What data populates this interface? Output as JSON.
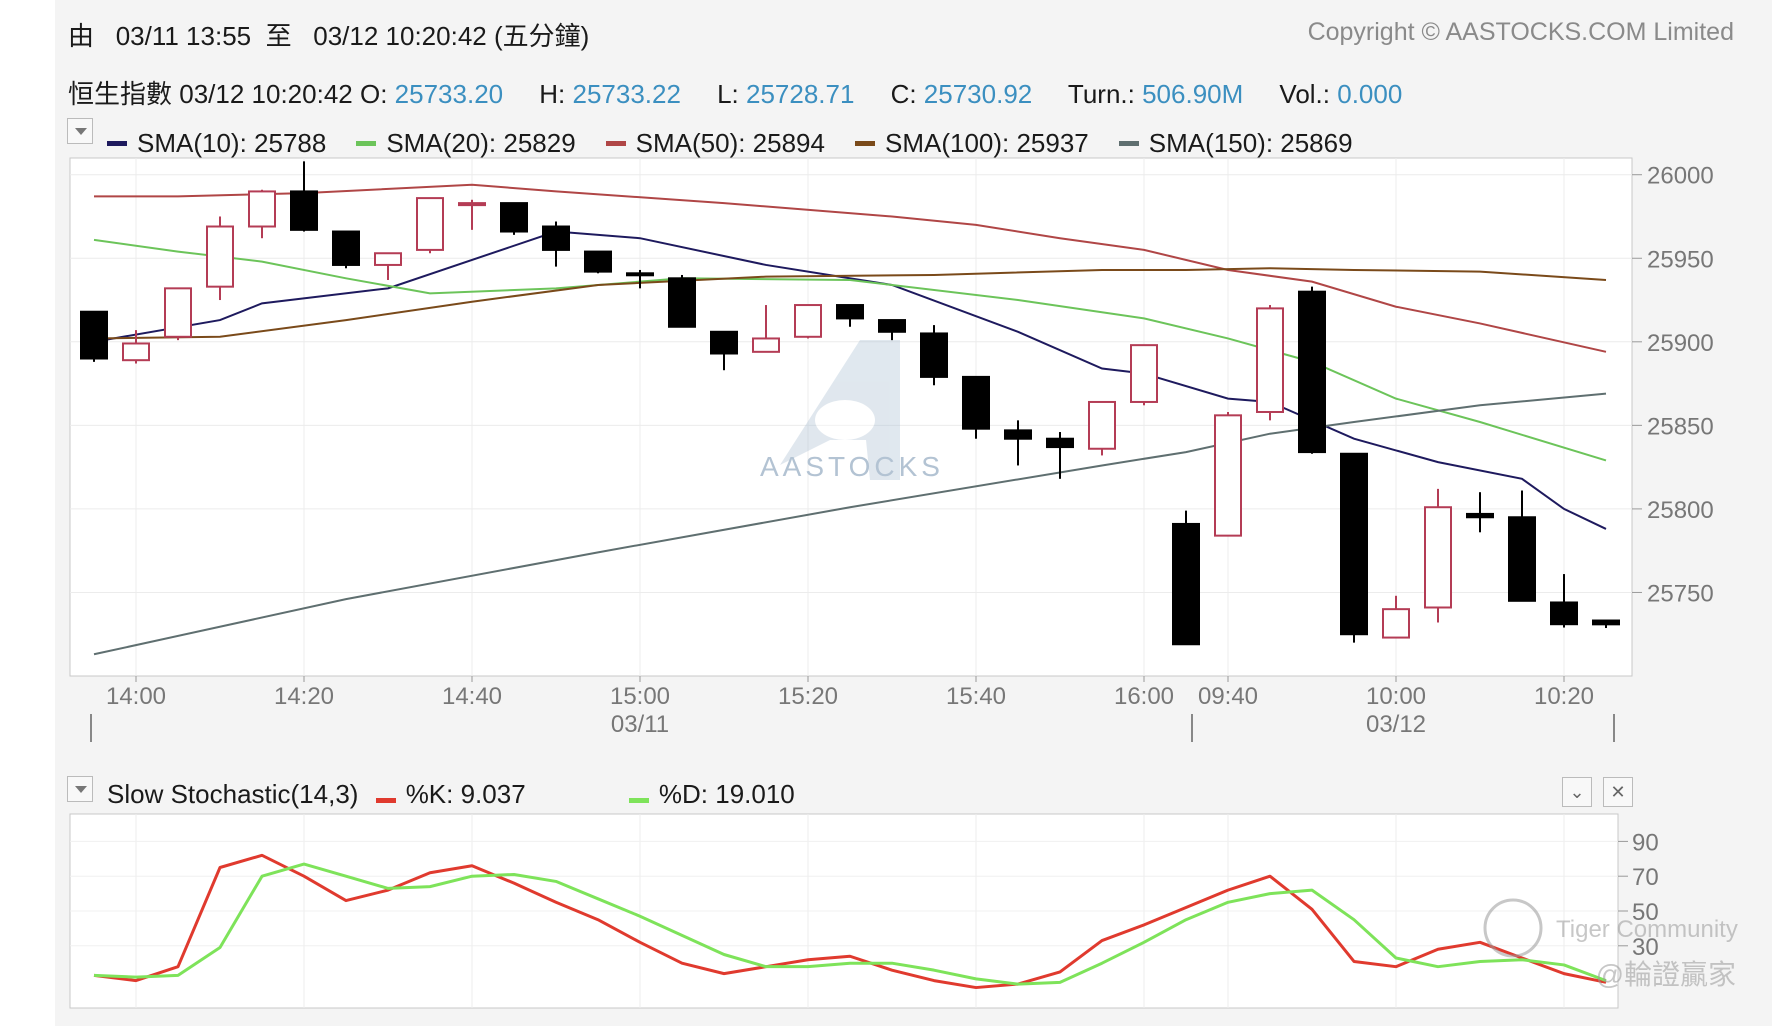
{
  "header": {
    "range_prefix": "由",
    "range_from": "03/11 13:55",
    "range_mid": "至",
    "range_to": "03/12 10:20:42 (五分鐘)",
    "copyright": "Copyright © AASTOCKS.COM Limited"
  },
  "quote": {
    "name": "恒生指數",
    "time": "03/12 10:20:42",
    "open_label": "O:",
    "open": "25733.20",
    "high_label": "H:",
    "high": "25733.22",
    "low_label": "L:",
    "low": "25728.71",
    "close_label": "C:",
    "close": "25730.92",
    "turn_label": "Turn.:",
    "turn": "506.90M",
    "vol_label": "Vol.:",
    "vol": "0.000"
  },
  "sma_legend": [
    {
      "label": "SMA(10): 25788",
      "color": "#1e1a5e"
    },
    {
      "label": "SMA(20): 25829",
      "color": "#6cc45a"
    },
    {
      "label": "SMA(50): 25894",
      "color": "#b04646"
    },
    {
      "label": "SMA(100): 25937",
      "color": "#7a4a1a"
    },
    {
      "label": "SMA(150): 25869",
      "color": "#5f6f70"
    }
  ],
  "stoch_legend": {
    "title": "Slow Stochastic(14,3)",
    "k_label": "%K: 9.037",
    "k_color": "#e03a2e",
    "d_label": "%D: 19.010",
    "d_color": "#7ee35a"
  },
  "watermarks": {
    "center": "AASTOCKS",
    "community": "Tiger Community",
    "author": "@輪證贏家"
  },
  "chart_data": [
    {
      "type": "candlestick",
      "title": "恒生指數",
      "ylim": [
        25700,
        26010
      ],
      "y_ticks": [
        26000,
        25950,
        25900,
        25850,
        25800,
        25750
      ],
      "x_tick_labels": [
        "14:00",
        "14:20",
        "14:40",
        "15:00",
        "15:20",
        "15:40",
        "16:00",
        "09:40",
        "10:00",
        "10:20"
      ],
      "date_labels": [
        "03/11",
        "03/12"
      ],
      "bull_color": "#b43c55",
      "bear_color": "#000000",
      "candles": [
        {
          "time": "13:55",
          "o": 25918,
          "h": 25918,
          "l": 25888,
          "c": 25890
        },
        {
          "time": "14:00",
          "o": 25889,
          "h": 25907,
          "l": 25887,
          "c": 25899
        },
        {
          "time": "14:05",
          "o": 25903,
          "h": 25931,
          "l": 25901,
          "c": 25932
        },
        {
          "time": "14:10",
          "o": 25933,
          "h": 25975,
          "l": 25925,
          "c": 25969
        },
        {
          "time": "14:15",
          "o": 25969,
          "h": 25991,
          "l": 25962,
          "c": 25990
        },
        {
          "time": "14:20",
          "o": 25990,
          "h": 26008,
          "l": 25966,
          "c": 25967
        },
        {
          "time": "14:25",
          "o": 25966,
          "h": 25966,
          "l": 25944,
          "c": 25946
        },
        {
          "time": "14:30",
          "o": 25946,
          "h": 25951,
          "l": 25937,
          "c": 25953
        },
        {
          "time": "14:35",
          "o": 25955,
          "h": 25986,
          "l": 25953,
          "c": 25986
        },
        {
          "time": "14:40",
          "o": 25983,
          "h": 25985,
          "l": 25967,
          "c": 25983
        },
        {
          "time": "14:45",
          "o": 25983,
          "h": 25983,
          "l": 25964,
          "c": 25966
        },
        {
          "time": "14:50",
          "o": 25969,
          "h": 25972,
          "l": 25945,
          "c": 25955
        },
        {
          "time": "14:55",
          "o": 25954,
          "h": 25954,
          "l": 25941,
          "c": 25942
        },
        {
          "time": "15:00",
          "o": 25941,
          "h": 25943,
          "l": 25932,
          "c": 25940
        },
        {
          "time": "15:05",
          "o": 25938,
          "h": 25940,
          "l": 25909,
          "c": 25909
        },
        {
          "time": "15:10",
          "o": 25906,
          "h": 25906,
          "l": 25883,
          "c": 25893
        },
        {
          "time": "15:15",
          "o": 25894,
          "h": 25922,
          "l": 25894,
          "c": 25902
        },
        {
          "time": "15:20",
          "o": 25903,
          "h": 25922,
          "l": 25902,
          "c": 25922
        },
        {
          "time": "15:25",
          "o": 25922,
          "h": 25922,
          "l": 25909,
          "c": 25914
        },
        {
          "time": "15:30",
          "o": 25913,
          "h": 25913,
          "l": 25901,
          "c": 25906
        },
        {
          "time": "15:35",
          "o": 25905,
          "h": 25910,
          "l": 25874,
          "c": 25879
        },
        {
          "time": "15:40",
          "o": 25879,
          "h": 25879,
          "l": 25842,
          "c": 25848
        },
        {
          "time": "15:45",
          "o": 25847,
          "h": 25853,
          "l": 25826,
          "c": 25842
        },
        {
          "time": "15:50",
          "o": 25842,
          "h": 25846,
          "l": 25818,
          "c": 25837
        },
        {
          "time": "15:55",
          "o": 25836,
          "h": 25864,
          "l": 25832,
          "c": 25864
        },
        {
          "time": "16:00",
          "o": 25864,
          "h": 25898,
          "l": 25862,
          "c": 25898
        },
        {
          "time": "09:35",
          "o": 25791,
          "h": 25799,
          "l": 25719,
          "c": 25719
        },
        {
          "time": "09:40",
          "o": 25784,
          "h": 25858,
          "l": 25784,
          "c": 25856
        },
        {
          "time": "09:45",
          "o": 25858,
          "h": 25922,
          "l": 25853,
          "c": 25920
        },
        {
          "time": "09:50",
          "o": 25930,
          "h": 25933,
          "l": 25833,
          "c": 25834
        },
        {
          "time": "09:55",
          "o": 25833,
          "h": 25833,
          "l": 25720,
          "c": 25725
        },
        {
          "time": "10:00",
          "o": 25723,
          "h": 25748,
          "l": 25723,
          "c": 25740
        },
        {
          "time": "10:05",
          "o": 25741,
          "h": 25812,
          "l": 25732,
          "c": 25801
        },
        {
          "time": "10:10",
          "o": 25797,
          "h": 25810,
          "l": 25786,
          "c": 25795
        },
        {
          "time": "10:15",
          "o": 25795,
          "h": 25811,
          "l": 25745,
          "c": 25745
        },
        {
          "time": "10:20",
          "o": 25744,
          "h": 25761,
          "l": 25729,
          "c": 25731
        },
        {
          "time": "10:20:42",
          "o": 25733.2,
          "h": 25733.22,
          "l": 25728.71,
          "c": 25730.92
        }
      ],
      "sma": [
        {
          "name": "SMA(10)",
          "color": "#1e1a5e",
          "points": [
            [
              0,
              25900
            ],
            [
              3,
              25913
            ],
            [
              4,
              25923
            ],
            [
              7,
              25932
            ],
            [
              11,
              25966
            ],
            [
              13,
              25962
            ],
            [
              16,
              25946
            ],
            [
              19,
              25934
            ],
            [
              22,
              25906
            ],
            [
              24,
              25884
            ],
            [
              25,
              25881
            ],
            [
              27,
              25866
            ],
            [
              28,
              25864
            ],
            [
              30,
              25842
            ],
            [
              32,
              25828
            ],
            [
              34,
              25818
            ],
            [
              35,
              25800
            ],
            [
              36,
              25788
            ]
          ]
        },
        {
          "name": "SMA(20)",
          "color": "#6cc45a",
          "points": [
            [
              0,
              25961
            ],
            [
              2,
              25954
            ],
            [
              4,
              25948
            ],
            [
              6,
              25938
            ],
            [
              8,
              25929
            ],
            [
              11,
              25932
            ],
            [
              14,
              25938
            ],
            [
              18,
              25937
            ],
            [
              22,
              25925
            ],
            [
              25,
              25914
            ],
            [
              27,
              25902
            ],
            [
              29,
              25888
            ],
            [
              31,
              25866
            ],
            [
              33,
              25852
            ],
            [
              36,
              25829
            ]
          ]
        },
        {
          "name": "SMA(50)",
          "color": "#b04646",
          "points": [
            [
              0,
              25987
            ],
            [
              2,
              25987
            ],
            [
              5,
              25989
            ],
            [
              9,
              25994
            ],
            [
              11,
              25990
            ],
            [
              15,
              25983
            ],
            [
              19,
              25975
            ],
            [
              21,
              25970
            ],
            [
              23,
              25962
            ],
            [
              25,
              25955
            ],
            [
              27,
              25943
            ],
            [
              29,
              25936
            ],
            [
              31,
              25921
            ],
            [
              33,
              25911
            ],
            [
              36,
              25894
            ]
          ]
        },
        {
          "name": "SMA(100)",
          "color": "#7a4a1a",
          "points": [
            [
              0,
              25902
            ],
            [
              3,
              25903
            ],
            [
              6,
              25913
            ],
            [
              9,
              25924
            ],
            [
              12,
              25934
            ],
            [
              16,
              25939
            ],
            [
              20,
              25940
            ],
            [
              24,
              25943
            ],
            [
              26,
              25943
            ],
            [
              28,
              25944
            ],
            [
              30,
              25943
            ],
            [
              33,
              25942
            ],
            [
              36,
              25937
            ]
          ]
        },
        {
          "name": "SMA(150)",
          "color": "#5f6f70",
          "points": [
            [
              0,
              25713
            ],
            [
              6,
              25746
            ],
            [
              12,
              25774
            ],
            [
              18,
              25801
            ],
            [
              24,
              25826
            ],
            [
              26,
              25834
            ],
            [
              28,
              25845
            ],
            [
              30,
              25852
            ],
            [
              33,
              25862
            ],
            [
              36,
              25869
            ]
          ]
        }
      ]
    },
    {
      "type": "line",
      "title": "Slow Stochastic(14,3)",
      "ylim": [
        0,
        100
      ],
      "y_ticks": [
        90,
        70,
        50,
        30
      ],
      "series": [
        {
          "name": "%K",
          "color": "#e03a2e",
          "values": [
            13,
            10,
            18,
            75,
            82,
            70,
            56,
            62,
            72,
            76,
            66,
            55,
            45,
            32,
            20,
            14,
            18,
            22,
            24,
            16,
            10,
            6,
            8,
            15,
            33,
            42,
            52,
            62,
            70,
            51,
            21,
            18,
            28,
            32,
            23,
            14,
            9
          ]
        },
        {
          "name": "%D",
          "color": "#7ee35a",
          "values": [
            13,
            12,
            13,
            29,
            70,
            77,
            70,
            63,
            64,
            70,
            71,
            67,
            57,
            47,
            36,
            25,
            18,
            18,
            20,
            20,
            16,
            11,
            8,
            9,
            20,
            32,
            45,
            55,
            60,
            62,
            45,
            23,
            18,
            21,
            22,
            19,
            10
          ]
        }
      ]
    }
  ]
}
